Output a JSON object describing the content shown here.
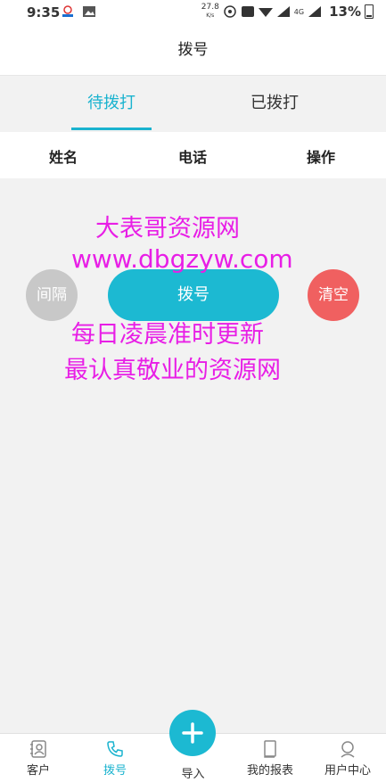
{
  "status_bar": {
    "time": "9:35",
    "speed": "27.8",
    "speed_unit": "K/s",
    "network": "4G",
    "battery": "13%"
  },
  "nav": {
    "title": "拨号"
  },
  "tabs": [
    {
      "label": "待拨打",
      "active": true
    },
    {
      "label": "已拨打",
      "active": false
    }
  ],
  "table_header": {
    "name": "姓名",
    "phone": "电话",
    "action": "操作"
  },
  "buttons": {
    "interval": "间隔",
    "dial": "拨号",
    "clear": "清空"
  },
  "watermark": {
    "line1": "大表哥资源网",
    "line2": "www.dbgzyw.com",
    "line3": "每日凌晨准时更新",
    "line4": "最认真敬业的资源网"
  },
  "bottom_nav": {
    "customers": "客户",
    "dial": "拨号",
    "import": "导入",
    "reports": "我的报表",
    "user_center": "用户中心"
  },
  "colors": {
    "accent": "#1cb9d2",
    "clear": "#f06060",
    "interval": "#c8c8c8",
    "watermark": "#e81ee6"
  }
}
